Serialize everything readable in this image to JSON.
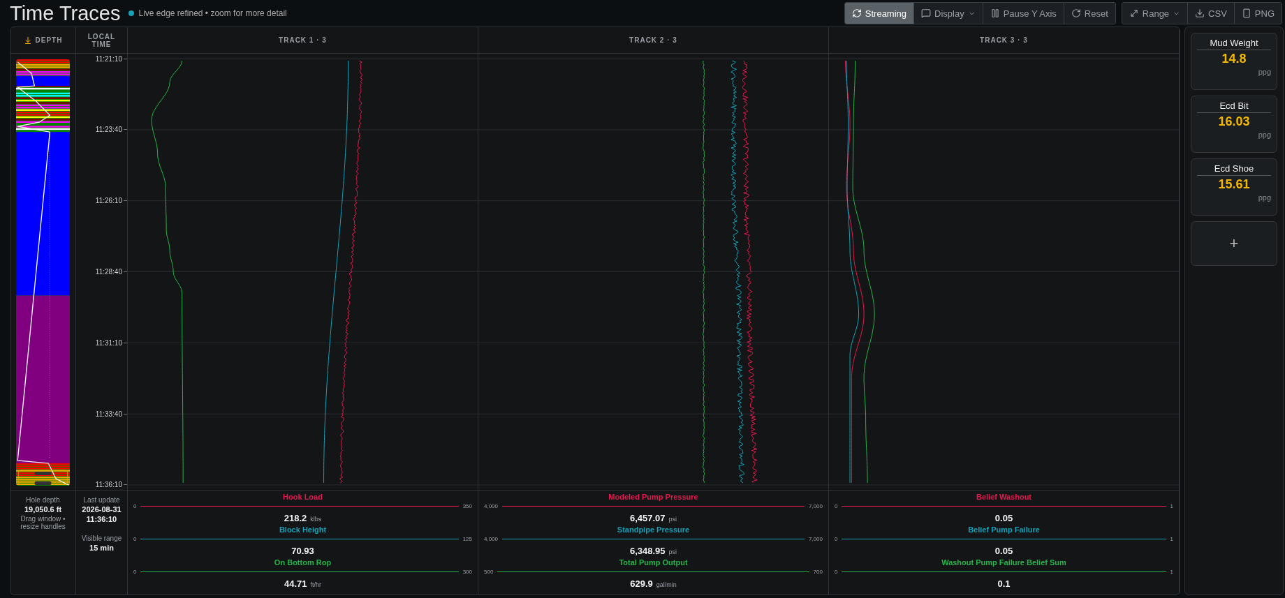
{
  "title": "Time Traces",
  "status": {
    "text": "Live edge refined • zoom for more detail",
    "live": true
  },
  "toolbar": [
    [
      {
        "label": "Streaming",
        "selected": true,
        "dropdown": false
      },
      {
        "label": "Display",
        "selected": false,
        "dropdown": true
      },
      {
        "label": "Pause Y Axis",
        "selected": false,
        "dropdown": false
      },
      {
        "label": "Reset",
        "selected": false,
        "dropdown": false
      }
    ],
    [
      {
        "label": "Range",
        "selected": false,
        "dropdown": true
      },
      {
        "label": "CSV",
        "selected": false,
        "dropdown": false
      },
      {
        "label": "PNG",
        "selected": false,
        "dropdown": false
      }
    ]
  ],
  "depth_header": "DEPTH",
  "time_header": "LOCAL TIME",
  "time_ticks": [
    "11:21:10",
    "11:23:40",
    "11:26:10",
    "11:28:40",
    "11:31:10",
    "11:33:40",
    "11:36:10"
  ],
  "tracks": [
    {
      "title": "TRACK 1 · 3",
      "curves": [
        {
          "name": "Hook Load",
          "color": "#e8194f",
          "min": "0",
          "max": "350",
          "value": "218.2",
          "unit": "klbs"
        },
        {
          "name": "Block Height",
          "color": "#17a2b8",
          "min": "0",
          "max": "125",
          "value": "70.93"
        },
        {
          "name": "On Bottom Rop",
          "color": "#28b44a",
          "min": "0",
          "max": "300",
          "value": "44.71",
          "unit": "ft/hr"
        }
      ]
    },
    {
      "title": "TRACK 2 · 3",
      "curves": [
        {
          "name": "Modeled Pump Pressure",
          "color": "#e8194f",
          "min": "4,000",
          "max": "7,000",
          "value": "6,457.07",
          "unit": "psi"
        },
        {
          "name": "Standpipe Pressure",
          "color": "#17a2b8",
          "min": "4,000",
          "max": "7,000",
          "value": "6,348.95",
          "unit": "psi"
        },
        {
          "name": "Total Pump Output",
          "color": "#28b44a",
          "min": "500",
          "max": "700",
          "value": "629.9",
          "unit": "gal/min"
        }
      ]
    },
    {
      "title": "TRACK 3 · 3",
      "curves": [
        {
          "name": "Belief Washout",
          "color": "#e8194f",
          "min": "0",
          "max": "1",
          "value": "0.05"
        },
        {
          "name": "Belief Pump Failure",
          "color": "#17a2b8",
          "min": "0",
          "max": "1",
          "value": "0.05"
        },
        {
          "name": "Washout Pump Failure Belief Sum",
          "color": "#28b44a",
          "min": "0",
          "max": "1",
          "value": "0.1"
        }
      ]
    }
  ],
  "hole_depth": {
    "label": "Hole depth",
    "value": "19,050.6 ft",
    "hint": "Drag window • resize handles"
  },
  "last_update": {
    "label": "Last update",
    "date": "2026-08-31",
    "time": "11:36:10"
  },
  "visible_range": {
    "label": "Visible range",
    "value": "15 min"
  },
  "cards": [
    {
      "title": "Mud Weight",
      "value": "14.8",
      "unit": "ppg"
    },
    {
      "title": "Ecd Bit",
      "value": "16.03",
      "unit": "ppg"
    },
    {
      "title": "Ecd Shoe",
      "value": "15.61",
      "unit": "ppg"
    }
  ],
  "add_button": "+"
}
